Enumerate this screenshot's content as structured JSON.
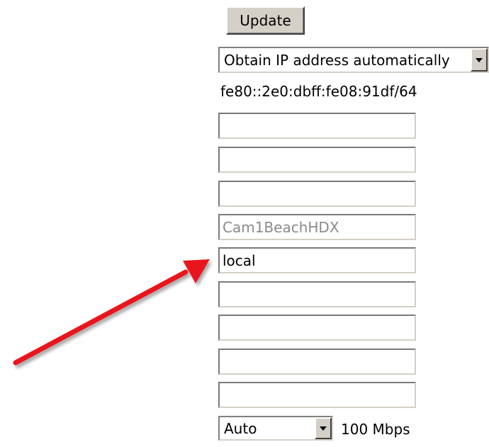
{
  "form": {
    "update_label": "Update",
    "ip_mode_selected": "Obtain IP address automatically",
    "ipv6_address": "fe80::2e0:dbff:fe08:91df/64",
    "fields": [
      {
        "value": "",
        "disabled": false
      },
      {
        "value": "",
        "disabled": false
      },
      {
        "value": "",
        "disabled": false
      },
      {
        "value": "Cam1BeachHDX",
        "disabled": true
      },
      {
        "value": "local",
        "disabled": false
      },
      {
        "value": "",
        "disabled": false
      },
      {
        "value": "",
        "disabled": false
      },
      {
        "value": "",
        "disabled": false
      },
      {
        "value": "",
        "disabled": false
      }
    ],
    "speed_selected": "Auto",
    "speed_status": "100 Mbps"
  },
  "annotation": {
    "arrow_color": "#e8141c"
  },
  "icons": {
    "dropdown": "chevron-down-icon"
  }
}
